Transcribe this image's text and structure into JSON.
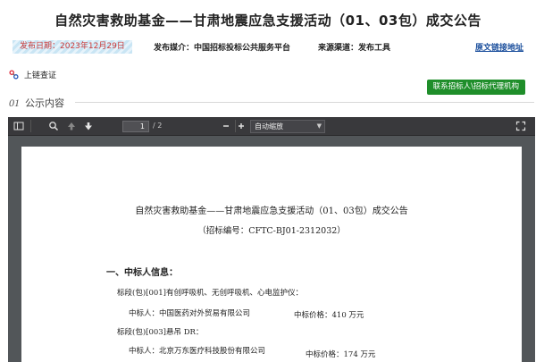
{
  "header": {
    "title": "自然灾害救助基金——甘肃地震应急支援活动（01、03包）成交公告"
  },
  "meta": {
    "publish_date": "发布日期：2023年12月29日",
    "media": "发布媒介：中国招标投标公共服务平台",
    "source": "来源渠道：发布工具",
    "original_link": "原文链接地址"
  },
  "chain_label": "上链查证",
  "contact_button": "联系招标人\\招标代理机构",
  "section": {
    "number": "01",
    "label": "公示内容"
  },
  "viewer": {
    "page_current": "1",
    "page_total": "/ 2",
    "zoom": "自动缩放",
    "icons": [
      "sidebar-toggle-icon",
      "search-icon",
      "previous-page-icon",
      "next-page-icon",
      "zoom-out-icon",
      "zoom-in-icon",
      "fullscreen-icon"
    ]
  },
  "document": {
    "title": "自然灾害救助基金——甘肃地震应急支援活动（01、03包）成交公告",
    "code": "（招标编号：CFTC-BJ01-2312032）",
    "section1": "一、中标人信息：",
    "lot1": "标段(包)[001]有创呼吸机、无创呼吸机、心电监护仪：",
    "lot1_winner": "中标人：中国医药对外贸易有限公司",
    "lot1_price": "中标价格：410 万元",
    "lot3": "标段(包)[003]悬吊 DR：",
    "lot3_winner": "中标人：北京万东医疗科技股份有限公司",
    "lot3_price": "中标价格：174 万元"
  },
  "colors": {
    "accent_green": "#1f8e2a",
    "date_red": "#c83a3a",
    "link_blue": "#1a4e9c",
    "viewer_bg": "#525659"
  }
}
